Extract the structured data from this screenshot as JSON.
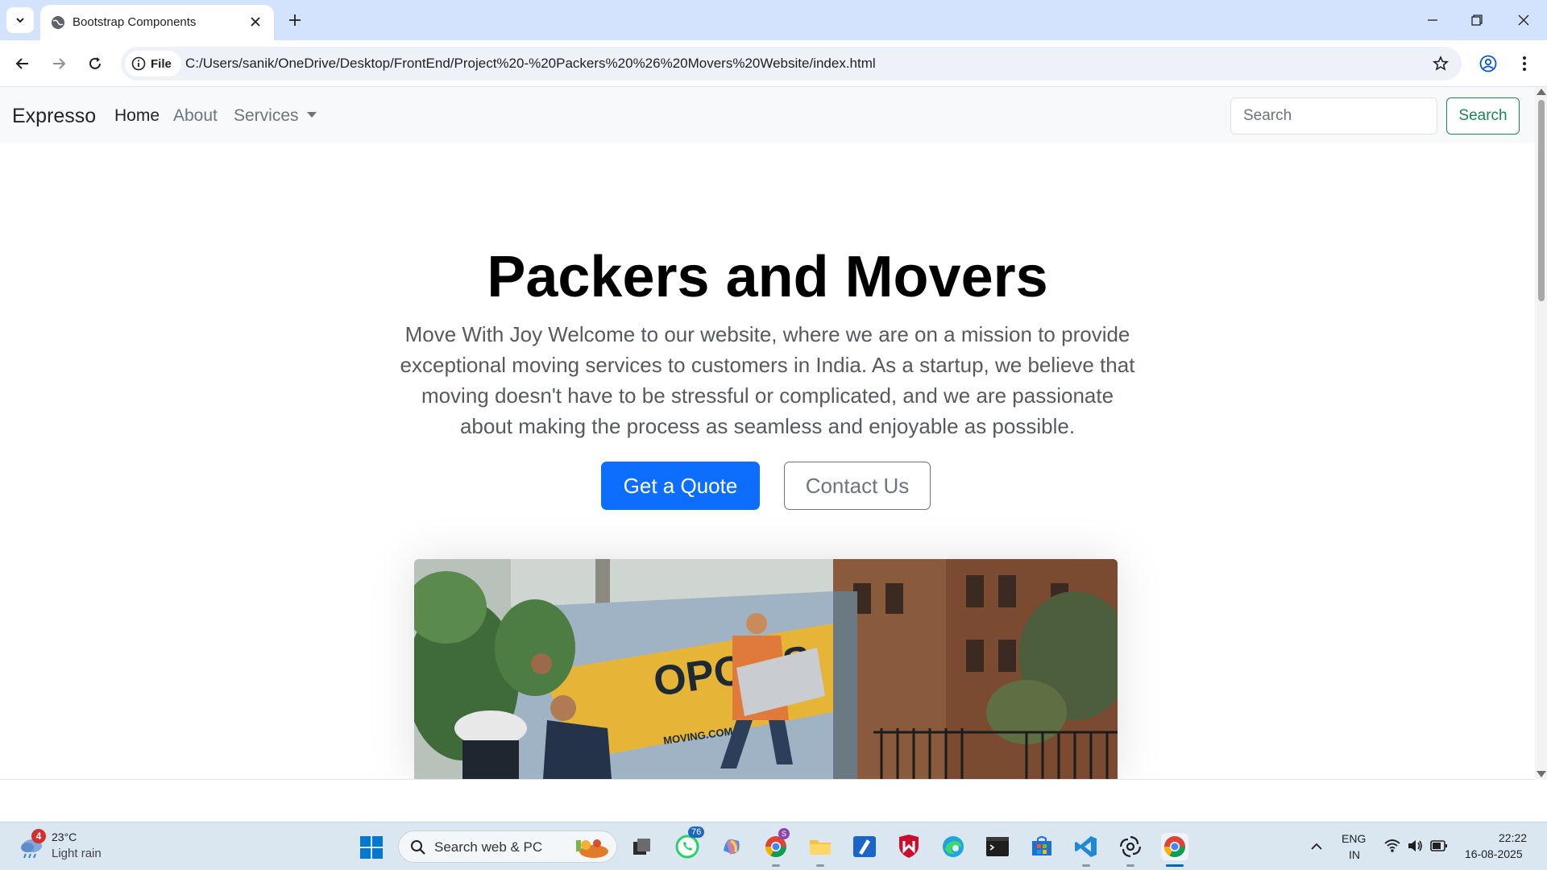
{
  "browser": {
    "tab_title": "Bootstrap Components",
    "site_chip": "File",
    "url": "C:/Users/sanik/OneDrive/Desktop/FrontEnd/Project%20-%20Packers%20%26%20Movers%20Website/index.html"
  },
  "navbar": {
    "brand": "Expresso",
    "links": [
      {
        "label": "Home"
      },
      {
        "label": "About"
      },
      {
        "label": "Services"
      }
    ],
    "search_placeholder": "Search",
    "search_button": "Search"
  },
  "hero": {
    "title": "Packers and Movers",
    "lead": "Move With Joy Welcome to our website, where we are on a mission to provide exceptional moving services to customers in India. As a startup, we believe that moving doesn't have to be stressful or complicated, and we are passionate about making the process as seamless and enjoyable as possible.",
    "primary_button": "Get a Quote",
    "secondary_button": "Contact Us",
    "image_truck_text": "OPOLIS",
    "image_truck_url": "MOVING.COM"
  },
  "taskbar": {
    "weather_badge": "4",
    "weather_temp": "23°C",
    "weather_desc": "Light rain",
    "search_text": "Search web & PC",
    "whatsapp_badge": "76",
    "lang_line1": "ENG",
    "lang_line2": "IN",
    "time": "22:22",
    "date": "16-08-2025"
  },
  "colors": {
    "primary": "#0d6efd",
    "success": "#198754",
    "secondary": "#6c757d",
    "chrome_tabbar": "#d3e3fd"
  }
}
